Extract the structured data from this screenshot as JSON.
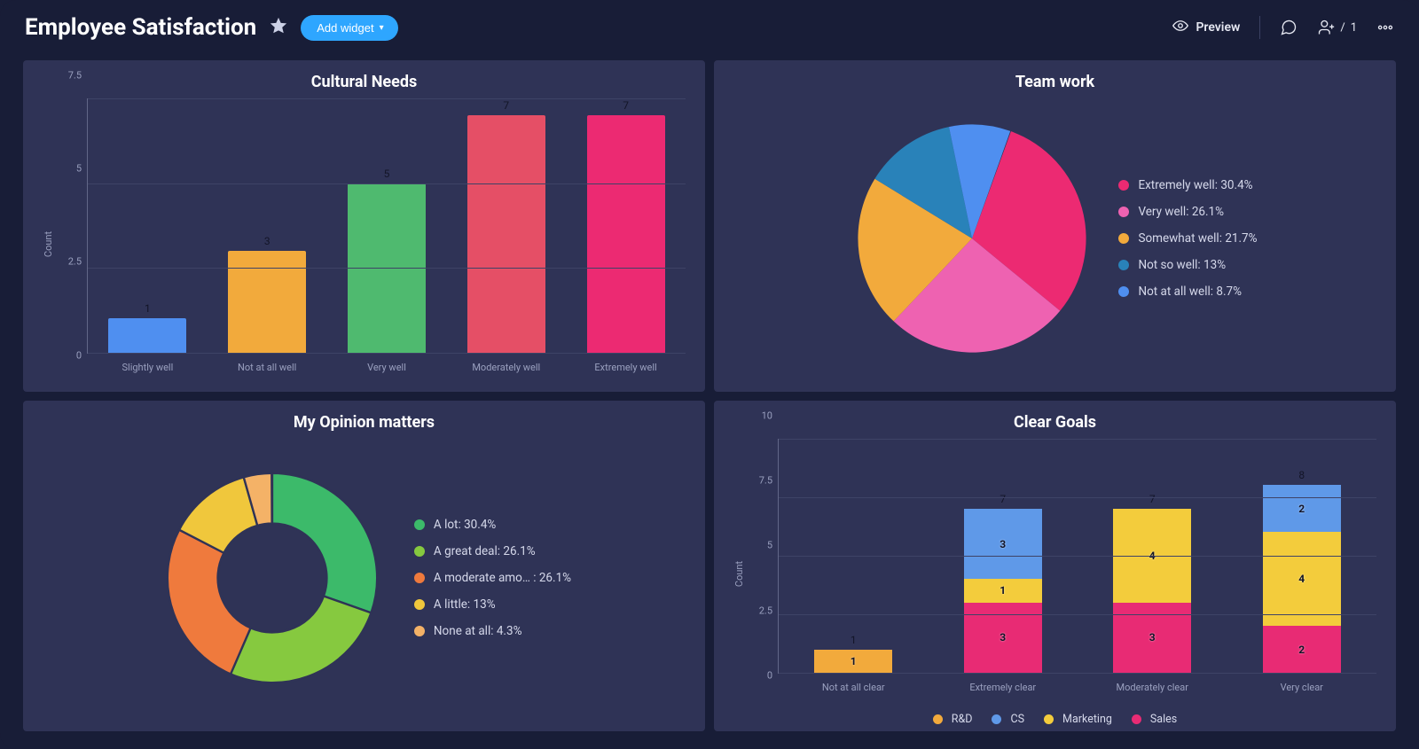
{
  "header": {
    "title": "Employee Satisfaction",
    "add_widget_label": "Add widget",
    "preview_label": "Preview",
    "share_count": "1"
  },
  "colors": {
    "blue": "#4f8ff0",
    "orange": "#f2aa3c",
    "green_mid": "#4fba6f",
    "red": "#e54f66",
    "pink": "#ec2a72",
    "bright_pink": "#ee62b1",
    "teal": "#2982b9",
    "green": "#3cba6a",
    "lime": "#86c93f",
    "orange2": "#ef7a3d",
    "yellow": "#f0c73c",
    "orange_light": "#f4b267",
    "cs_blue": "#5f99e8",
    "mk_yellow": "#f3cc3c",
    "sales_pink": "#e82b74",
    "rd_orange": "#f2aa3c"
  },
  "chart_data": [
    {
      "id": "cultural_needs",
      "type": "bar",
      "title": "Cultural Needs",
      "ylabel": "Count",
      "ylim": [
        0,
        7.5
      ],
      "y_ticks": [
        0,
        2.5,
        5,
        7.5
      ],
      "categories": [
        "Slightly well",
        "Not at all well",
        "Very well",
        "Moderately well",
        "Extremely well"
      ],
      "values": [
        1,
        3,
        5,
        7,
        7
      ],
      "bar_colors": [
        "blue",
        "orange",
        "green_mid",
        "red",
        "pink"
      ]
    },
    {
      "id": "team_work",
      "type": "pie",
      "title": "Team work",
      "slices": [
        {
          "label": "Extremely well",
          "pct": 30.4,
          "color": "pink"
        },
        {
          "label": "Very well",
          "pct": 26.1,
          "color": "bright_pink"
        },
        {
          "label": "Somewhat well",
          "pct": 21.7,
          "color": "orange"
        },
        {
          "label": "Not so well",
          "pct": 13.0,
          "color": "teal"
        },
        {
          "label": "Not at all well",
          "pct": 8.7,
          "color": "blue"
        }
      ]
    },
    {
      "id": "opinion_matters",
      "type": "donut",
      "title": "My Opinion matters",
      "slices": [
        {
          "label": "A lot",
          "pct": 30.4,
          "color": "green"
        },
        {
          "label": "A great deal",
          "pct": 26.1,
          "color": "lime"
        },
        {
          "label": "A moderate amo…  ",
          "pct": 26.1,
          "color": "orange2"
        },
        {
          "label": "A little",
          "pct": 13.0,
          "color": "yellow"
        },
        {
          "label": "None at all",
          "pct": 4.3,
          "color": "orange_light"
        }
      ]
    },
    {
      "id": "clear_goals",
      "type": "stacked_bar",
      "title": "Clear Goals",
      "ylabel": "Count",
      "ylim": [
        0,
        10
      ],
      "y_ticks": [
        0,
        2.5,
        5,
        7.5,
        10
      ],
      "categories": [
        "Not at all clear",
        "Extremely clear",
        "Moderately clear",
        "Very clear"
      ],
      "totals": [
        1,
        7,
        7,
        8
      ],
      "series": [
        {
          "name": "R&D",
          "color": "rd_orange",
          "values": [
            1,
            0,
            0,
            0
          ]
        },
        {
          "name": "CS",
          "color": "cs_blue",
          "values": [
            0,
            3,
            0,
            2
          ]
        },
        {
          "name": "Marketing",
          "color": "mk_yellow",
          "values": [
            0,
            1,
            4,
            4
          ]
        },
        {
          "name": "Sales",
          "color": "sales_pink",
          "values": [
            0,
            3,
            3,
            2
          ]
        }
      ],
      "stack_order": [
        "Sales",
        "Marketing",
        "R&D",
        "CS"
      ]
    }
  ]
}
